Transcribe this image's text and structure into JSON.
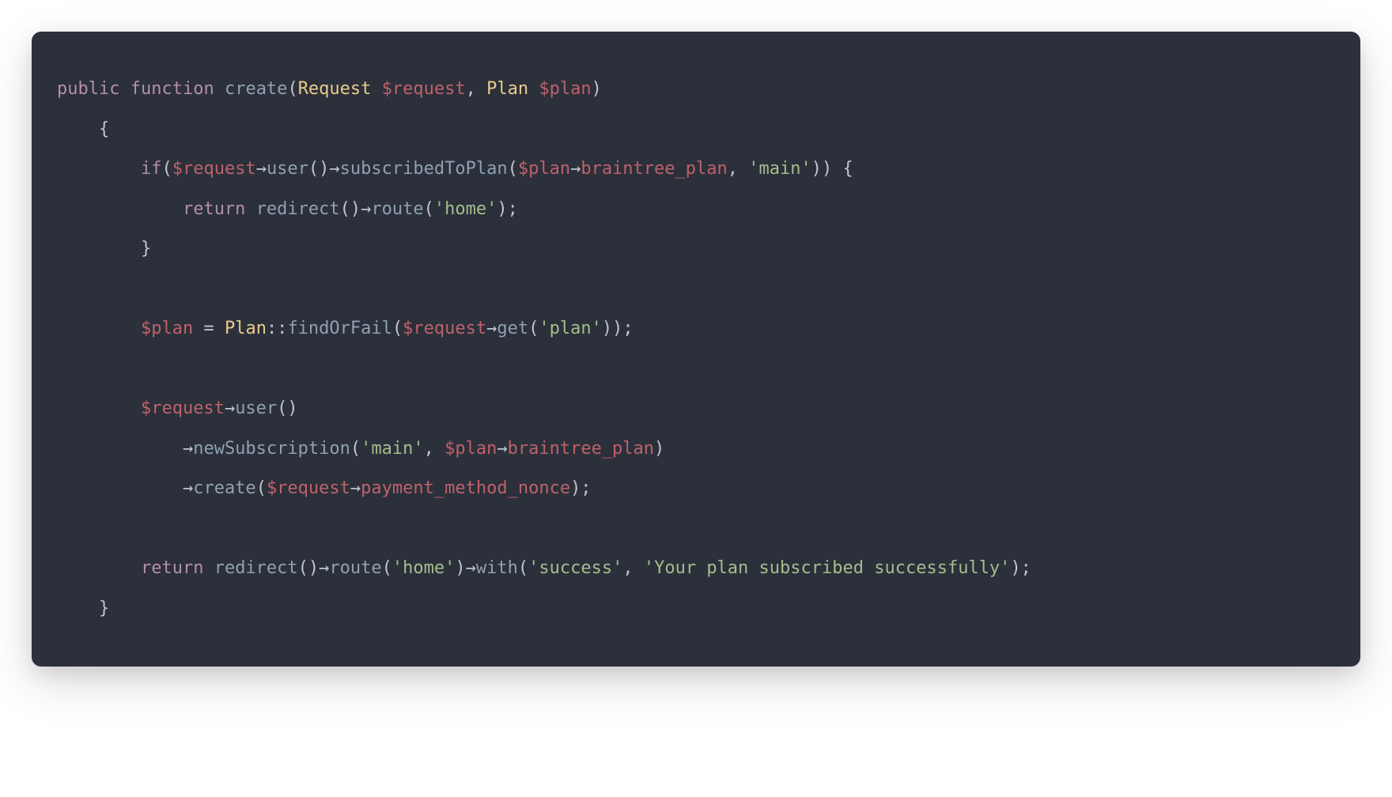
{
  "code": {
    "tokens": [
      [
        {
          "cls": "tok-keyword",
          "t": "public"
        },
        {
          "cls": "tok-plain",
          "t": " "
        },
        {
          "cls": "tok-keyword",
          "t": "function"
        },
        {
          "cls": "tok-plain",
          "t": " "
        },
        {
          "cls": "tok-function",
          "t": "create"
        },
        {
          "cls": "tok-punct",
          "t": "("
        },
        {
          "cls": "tok-type",
          "t": "Request"
        },
        {
          "cls": "tok-plain",
          "t": " "
        },
        {
          "cls": "tok-variable",
          "t": "$request"
        },
        {
          "cls": "tok-punct",
          "t": ", "
        },
        {
          "cls": "tok-type",
          "t": "Plan"
        },
        {
          "cls": "tok-plain",
          "t": " "
        },
        {
          "cls": "tok-variable",
          "t": "$plan"
        },
        {
          "cls": "tok-punct",
          "t": ")"
        }
      ],
      [
        {
          "cls": "tok-punct",
          "t": "    {"
        }
      ],
      [
        {
          "cls": "tok-plain",
          "t": "        "
        },
        {
          "cls": "tok-keyword",
          "t": "if"
        },
        {
          "cls": "tok-punct",
          "t": "("
        },
        {
          "cls": "tok-variable",
          "t": "$request"
        },
        {
          "cls": "tok-operator",
          "t": "→"
        },
        {
          "cls": "tok-method",
          "t": "user"
        },
        {
          "cls": "tok-punct",
          "t": "()"
        },
        {
          "cls": "tok-operator",
          "t": "→"
        },
        {
          "cls": "tok-method",
          "t": "subscribedToPlan"
        },
        {
          "cls": "tok-punct",
          "t": "("
        },
        {
          "cls": "tok-variable",
          "t": "$plan"
        },
        {
          "cls": "tok-operator",
          "t": "→"
        },
        {
          "cls": "tok-property",
          "t": "braintree_plan"
        },
        {
          "cls": "tok-punct",
          "t": ", "
        },
        {
          "cls": "tok-string",
          "t": "'main'"
        },
        {
          "cls": "tok-punct",
          "t": ")) {"
        }
      ],
      [
        {
          "cls": "tok-plain",
          "t": "            "
        },
        {
          "cls": "tok-keyword",
          "t": "return"
        },
        {
          "cls": "tok-plain",
          "t": " "
        },
        {
          "cls": "tok-method",
          "t": "redirect"
        },
        {
          "cls": "tok-punct",
          "t": "()"
        },
        {
          "cls": "tok-operator",
          "t": "→"
        },
        {
          "cls": "tok-method",
          "t": "route"
        },
        {
          "cls": "tok-punct",
          "t": "("
        },
        {
          "cls": "tok-string",
          "t": "'home'"
        },
        {
          "cls": "tok-punct",
          "t": ");"
        }
      ],
      [
        {
          "cls": "tok-punct",
          "t": "        }"
        }
      ],
      [
        {
          "cls": "tok-plain",
          "t": ""
        }
      ],
      [
        {
          "cls": "tok-plain",
          "t": "        "
        },
        {
          "cls": "tok-variable",
          "t": "$plan"
        },
        {
          "cls": "tok-plain",
          "t": " = "
        },
        {
          "cls": "tok-type",
          "t": "Plan"
        },
        {
          "cls": "tok-operator",
          "t": "::"
        },
        {
          "cls": "tok-method",
          "t": "findOrFail"
        },
        {
          "cls": "tok-punct",
          "t": "("
        },
        {
          "cls": "tok-variable",
          "t": "$request"
        },
        {
          "cls": "tok-operator",
          "t": "→"
        },
        {
          "cls": "tok-method",
          "t": "get"
        },
        {
          "cls": "tok-punct",
          "t": "("
        },
        {
          "cls": "tok-string",
          "t": "'plan'"
        },
        {
          "cls": "tok-punct",
          "t": "));"
        }
      ],
      [
        {
          "cls": "tok-plain",
          "t": ""
        }
      ],
      [
        {
          "cls": "tok-plain",
          "t": "        "
        },
        {
          "cls": "tok-variable",
          "t": "$request"
        },
        {
          "cls": "tok-operator",
          "t": "→"
        },
        {
          "cls": "tok-method",
          "t": "user"
        },
        {
          "cls": "tok-punct",
          "t": "()"
        }
      ],
      [
        {
          "cls": "tok-plain",
          "t": "            "
        },
        {
          "cls": "tok-operator",
          "t": "→"
        },
        {
          "cls": "tok-method",
          "t": "newSubscription"
        },
        {
          "cls": "tok-punct",
          "t": "("
        },
        {
          "cls": "tok-string",
          "t": "'main'"
        },
        {
          "cls": "tok-punct",
          "t": ", "
        },
        {
          "cls": "tok-variable",
          "t": "$plan"
        },
        {
          "cls": "tok-operator",
          "t": "→"
        },
        {
          "cls": "tok-property",
          "t": "braintree_plan"
        },
        {
          "cls": "tok-punct",
          "t": ")"
        }
      ],
      [
        {
          "cls": "tok-plain",
          "t": "            "
        },
        {
          "cls": "tok-operator",
          "t": "→"
        },
        {
          "cls": "tok-method",
          "t": "create"
        },
        {
          "cls": "tok-punct",
          "t": "("
        },
        {
          "cls": "tok-variable",
          "t": "$request"
        },
        {
          "cls": "tok-operator",
          "t": "→"
        },
        {
          "cls": "tok-property",
          "t": "payment_method_nonce"
        },
        {
          "cls": "tok-punct",
          "t": ");"
        }
      ],
      [
        {
          "cls": "tok-plain",
          "t": ""
        }
      ],
      [
        {
          "cls": "tok-plain",
          "t": "        "
        },
        {
          "cls": "tok-keyword",
          "t": "return"
        },
        {
          "cls": "tok-plain",
          "t": " "
        },
        {
          "cls": "tok-method",
          "t": "redirect"
        },
        {
          "cls": "tok-punct",
          "t": "()"
        },
        {
          "cls": "tok-operator",
          "t": "→"
        },
        {
          "cls": "tok-method",
          "t": "route"
        },
        {
          "cls": "tok-punct",
          "t": "("
        },
        {
          "cls": "tok-string",
          "t": "'home'"
        },
        {
          "cls": "tok-punct",
          "t": ")"
        },
        {
          "cls": "tok-operator",
          "t": "→"
        },
        {
          "cls": "tok-method",
          "t": "with"
        },
        {
          "cls": "tok-punct",
          "t": "("
        },
        {
          "cls": "tok-string",
          "t": "'success'"
        },
        {
          "cls": "tok-punct",
          "t": ", "
        },
        {
          "cls": "tok-string",
          "t": "'Your plan subscribed successfully'"
        },
        {
          "cls": "tok-punct",
          "t": ");"
        }
      ],
      [
        {
          "cls": "tok-punct",
          "t": "    }"
        }
      ]
    ]
  },
  "colors": {
    "background": "#2b303b",
    "keyword": "#b48ead",
    "function": "#8fa1b3",
    "type": "#ebcb8b",
    "variable": "#bf616a",
    "string": "#a3be8c",
    "default": "#c0c5ce"
  }
}
